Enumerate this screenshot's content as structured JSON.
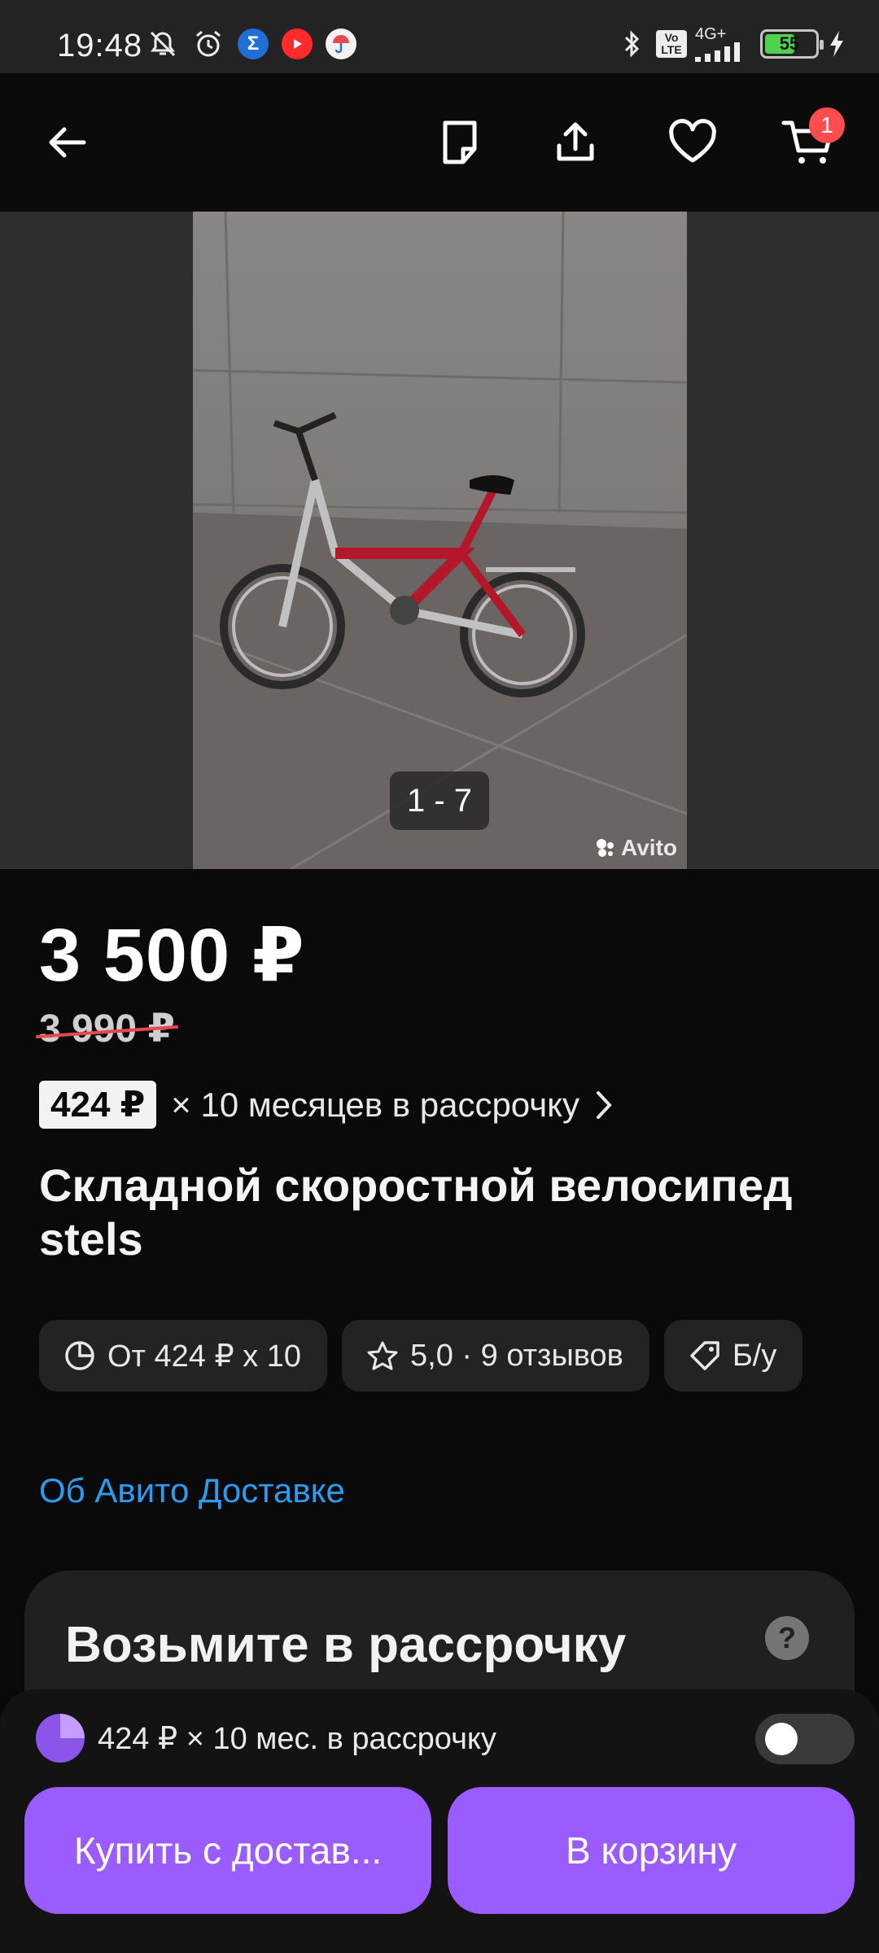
{
  "status_bar": {
    "time": "19:48",
    "network_label_top": "4G+",
    "network_label_lte": "Vo LTE",
    "battery": "55"
  },
  "app_bar": {
    "cart_count": "1"
  },
  "gallery": {
    "counter": "1 - 7",
    "watermark": "Avito"
  },
  "product": {
    "price": "3 500 ₽",
    "old_price": "3 990 ₽",
    "installment_amount": "424 ₽",
    "installment_text": "× 10 месяцев в рассрочку",
    "title": "Складной скоростной велосипед stels"
  },
  "chips": [
    {
      "label": "От 424 ₽ x 10",
      "icon": "pie-chart-icon"
    },
    {
      "label": "5,0 · 9 отзывов",
      "icon": "star-icon"
    },
    {
      "label": "Б/у",
      "icon": "tag-icon"
    }
  ],
  "delivery_link": "Об Авито Доставке",
  "installment_card": {
    "title": "Возьмите в рассрочку",
    "help": "?"
  },
  "bottom_bar": {
    "bnpl_text": "424 ₽ × 10 мес. в рассрочку",
    "buy_button": "Купить с достав...",
    "cart_button": "В корзину"
  },
  "colors": {
    "accent": "#9b5cff",
    "link": "#2c9cf0",
    "badge": "#ff4d4f"
  }
}
